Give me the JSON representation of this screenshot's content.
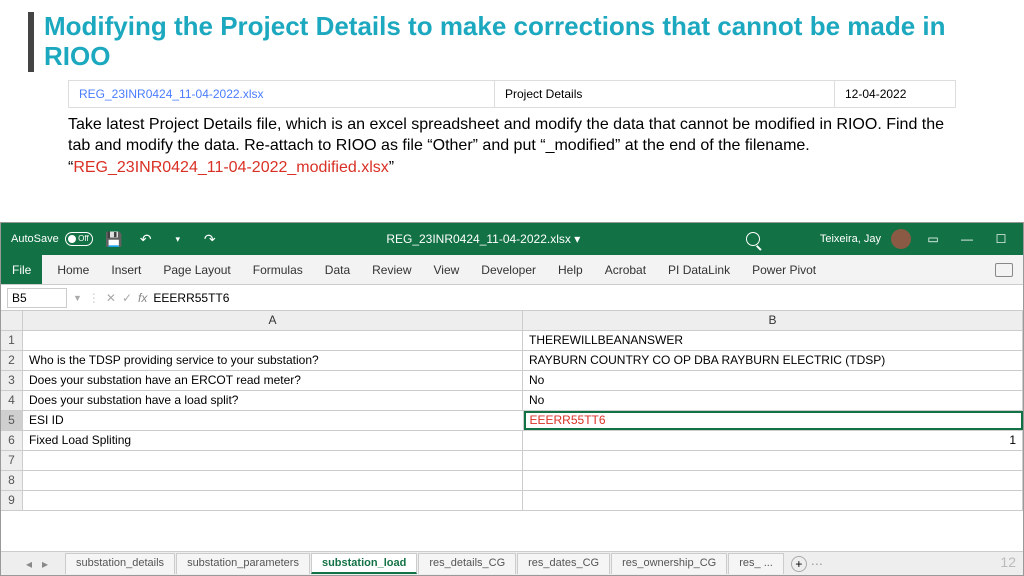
{
  "slide": {
    "title": "Modifying the Project Details to make corrections that cannot be made in RIOO",
    "pagenum": "12"
  },
  "filebar": {
    "filename": "REG_23INR0424_11-04-2022.xlsx",
    "desc": "Project Details",
    "date": "12-04-2022"
  },
  "instr": {
    "text": "Take latest Project Details file, which is an excel spreadsheet and modify the data that cannot be modified in RIOO.  Find the tab and modify the data.  Re-attach to RIOO as file “Other” and put “_modified” at the end of the filename.  “",
    "red": "REG_23INR0424_11-04-2022_modified.xlsx",
    "end": "”"
  },
  "excel": {
    "autosave": "AutoSave",
    "off": "Off",
    "filename": "REG_23INR0424_11-04-2022.xlsx",
    "user": "Teixeira, Jay",
    "ribbon": [
      "File",
      "Home",
      "Insert",
      "Page Layout",
      "Formulas",
      "Data",
      "Review",
      "View",
      "Developer",
      "Help",
      "Acrobat",
      "PI DataLink",
      "Power Pivot"
    ],
    "cellref": "B5",
    "fx": "fx",
    "fxval": "EEERR55TT6",
    "colA": "A",
    "colB": "B",
    "rows": [
      {
        "n": "1",
        "a": "",
        "b": "THEREWILLBEANANSWER"
      },
      {
        "n": "2",
        "a": "Who is the TDSP providing service to your substation?",
        "b": "RAYBURN COUNTRY CO OP DBA RAYBURN ELECTRIC (TDSP)"
      },
      {
        "n": "3",
        "a": "Does your substation have an ERCOT read meter?",
        "b": "No"
      },
      {
        "n": "4",
        "a": "Does your substation have a load split?",
        "b": "No"
      },
      {
        "n": "5",
        "a": "ESI ID",
        "b": "EEERR55TT6"
      },
      {
        "n": "6",
        "a": "Fixed Load Spliting",
        "b": "1"
      },
      {
        "n": "7",
        "a": "",
        "b": ""
      },
      {
        "n": "8",
        "a": "",
        "b": ""
      },
      {
        "n": "9",
        "a": "",
        "b": ""
      }
    ],
    "tabs": [
      "substation_details",
      "substation_parameters",
      "substation_load",
      "res_details_CG",
      "res_dates_CG",
      "res_ownership_CG",
      "res_ ..."
    ],
    "active_tab": 2,
    "plus": "+"
  }
}
